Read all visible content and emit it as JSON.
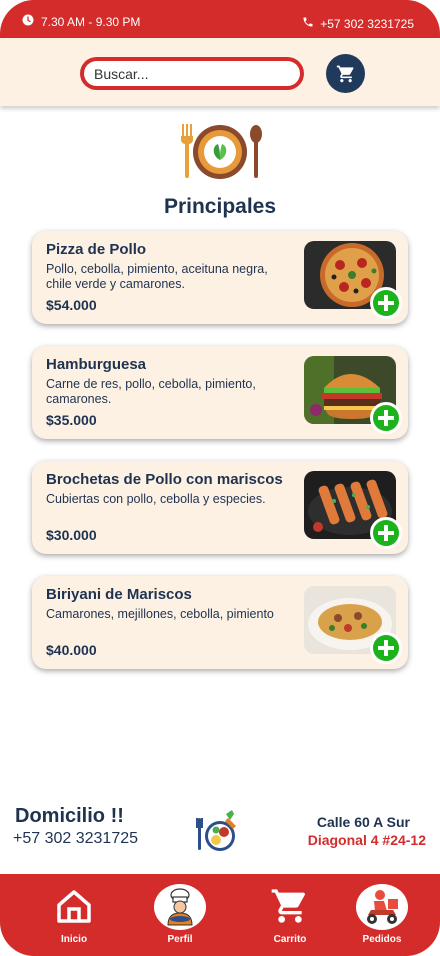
{
  "status_bar": {
    "hours": "7.30 AM - 9.30 PM",
    "phone": "+57 302 3231725",
    "icons": [
      "clock-icon",
      "phone-icon"
    ]
  },
  "search": {
    "placeholder": "Buscar...",
    "value": ""
  },
  "section": {
    "title": "Principales",
    "icon": "plate-cutlery-icon"
  },
  "menu_items": [
    {
      "name": "Pizza de Pollo",
      "description": "Pollo, cebolla, pimiento, aceituna negra, chile verde y camarones.",
      "price": "$54.000",
      "image": "pizza-image"
    },
    {
      "name": "Hamburguesa",
      "description": "Carne de res,  pollo, cebolla, pimiento, camarones.",
      "price": "$35.000",
      "image": "burger-image"
    },
    {
      "name": "Brochetas de Pollo con mariscos",
      "description": "Cubiertas con pollo, cebolla y especies.",
      "price": "$30.000",
      "image": "skewers-image"
    },
    {
      "name": "Biriyani de Mariscos",
      "description": "Camarones, mejillones, cebolla, pimiento",
      "price": "$40.000",
      "image": "biryani-image"
    }
  ],
  "delivery": {
    "title": "Domicilio !!",
    "phone": "+57 302 3231725",
    "address_line1": "Calle 60 A Sur",
    "address_line2": "Diagonal 4  #24-12"
  },
  "bottom_nav": [
    {
      "label": "Inicio",
      "icon": "home-icon"
    },
    {
      "label": "Perfil",
      "icon": "chef-icon"
    },
    {
      "label": "Carrito",
      "icon": "cart-icon"
    },
    {
      "label": "Pedidos",
      "icon": "delivery-scooter-icon"
    }
  ],
  "colors": {
    "brand_red": "#d42b2b",
    "navy": "#1f3a5a",
    "card_bg": "#fdf1e4",
    "add_green": "#1bb21b"
  }
}
